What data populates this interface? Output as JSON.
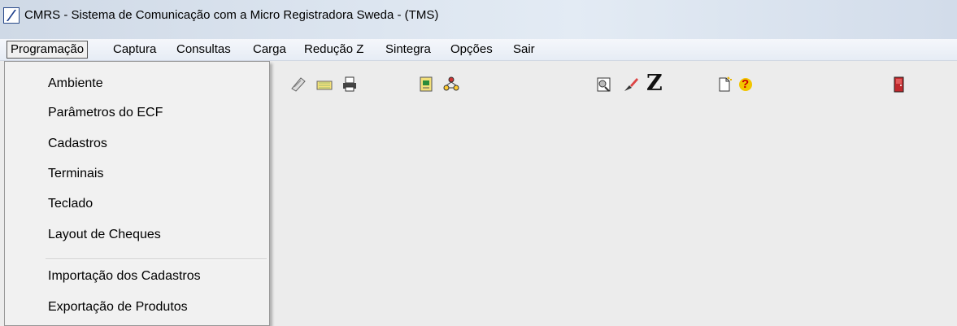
{
  "window": {
    "title": "CMRS - Sistema de Comunicação com a Micro Registradora Sweda - (TMS)"
  },
  "menubar": {
    "items": [
      "Programação",
      "Captura",
      "Consultas",
      "Carga",
      "Redução Z",
      "Sintegra",
      "Opções",
      "Sair"
    ],
    "active": "Programação"
  },
  "dropdown": {
    "items": [
      "Ambiente",
      "Parâmetros do ECF",
      "Cadastros",
      "Terminais",
      "Teclado",
      "Layout de Cheques"
    ],
    "items_after_separator": [
      "Importação dos Cadastros",
      "Exportação de Produtos"
    ]
  },
  "toolbar": {
    "icons": [
      "keyboard-icon",
      "check-icon",
      "envelope-icon",
      "printer-icon",
      "document-save-icon",
      "network-icon",
      "report-icon",
      "brush-icon",
      "reduction-z-icon",
      "new-document-icon",
      "help-icon",
      "exit-door-icon"
    ],
    "z_label": "Z",
    "help_glyph": "?"
  },
  "colors": {
    "title_bar": "#dbe4ef",
    "menu_bar": "#eef2f8",
    "background": "#ececec",
    "dropdown_bg": "#f1f1f1",
    "door_red": "#c0282c",
    "help_yellow": "#f2c500"
  }
}
